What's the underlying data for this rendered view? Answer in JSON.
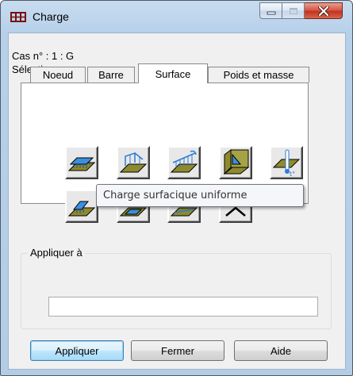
{
  "window": {
    "title": "Charge",
    "controls": {
      "minimize": "minimize-icon",
      "maximize": "maximize-icon",
      "close": "close-icon"
    }
  },
  "info": {
    "case_line": "Cas n° : 1 : G",
    "selection_line": "Sélection :"
  },
  "tabs": [
    {
      "label": "Noeud",
      "active": false
    },
    {
      "label": "Barre",
      "active": false
    },
    {
      "label": "Surface",
      "active": true
    },
    {
      "label": "Poids et masse",
      "active": false
    }
  ],
  "tools": [
    {
      "name": "uniform-surface-load-icon"
    },
    {
      "name": "linear-load-3-points-icon"
    },
    {
      "name": "contour-load-icon"
    },
    {
      "name": "hydrostatic-pressure-icon"
    },
    {
      "name": "thermal-load-icon"
    },
    {
      "name": "planar-load-on-contour-icon"
    },
    {
      "name": "planar-load-icon"
    },
    {
      "name": "linear-load-2-points-icon"
    },
    {
      "name": "self-weight-load-icon"
    }
  ],
  "tooltip": "Charge surfacique uniforme",
  "apply_to": {
    "label": "Appliquer à",
    "value": "",
    "placeholder": ""
  },
  "buttons": {
    "apply": "Appliquer",
    "close": "Fermer",
    "help": "Aide"
  },
  "colors": {
    "accent_blue": "#2b7bd8",
    "surface_olive": "#8f8a2e",
    "close_red": "#c3331f"
  }
}
